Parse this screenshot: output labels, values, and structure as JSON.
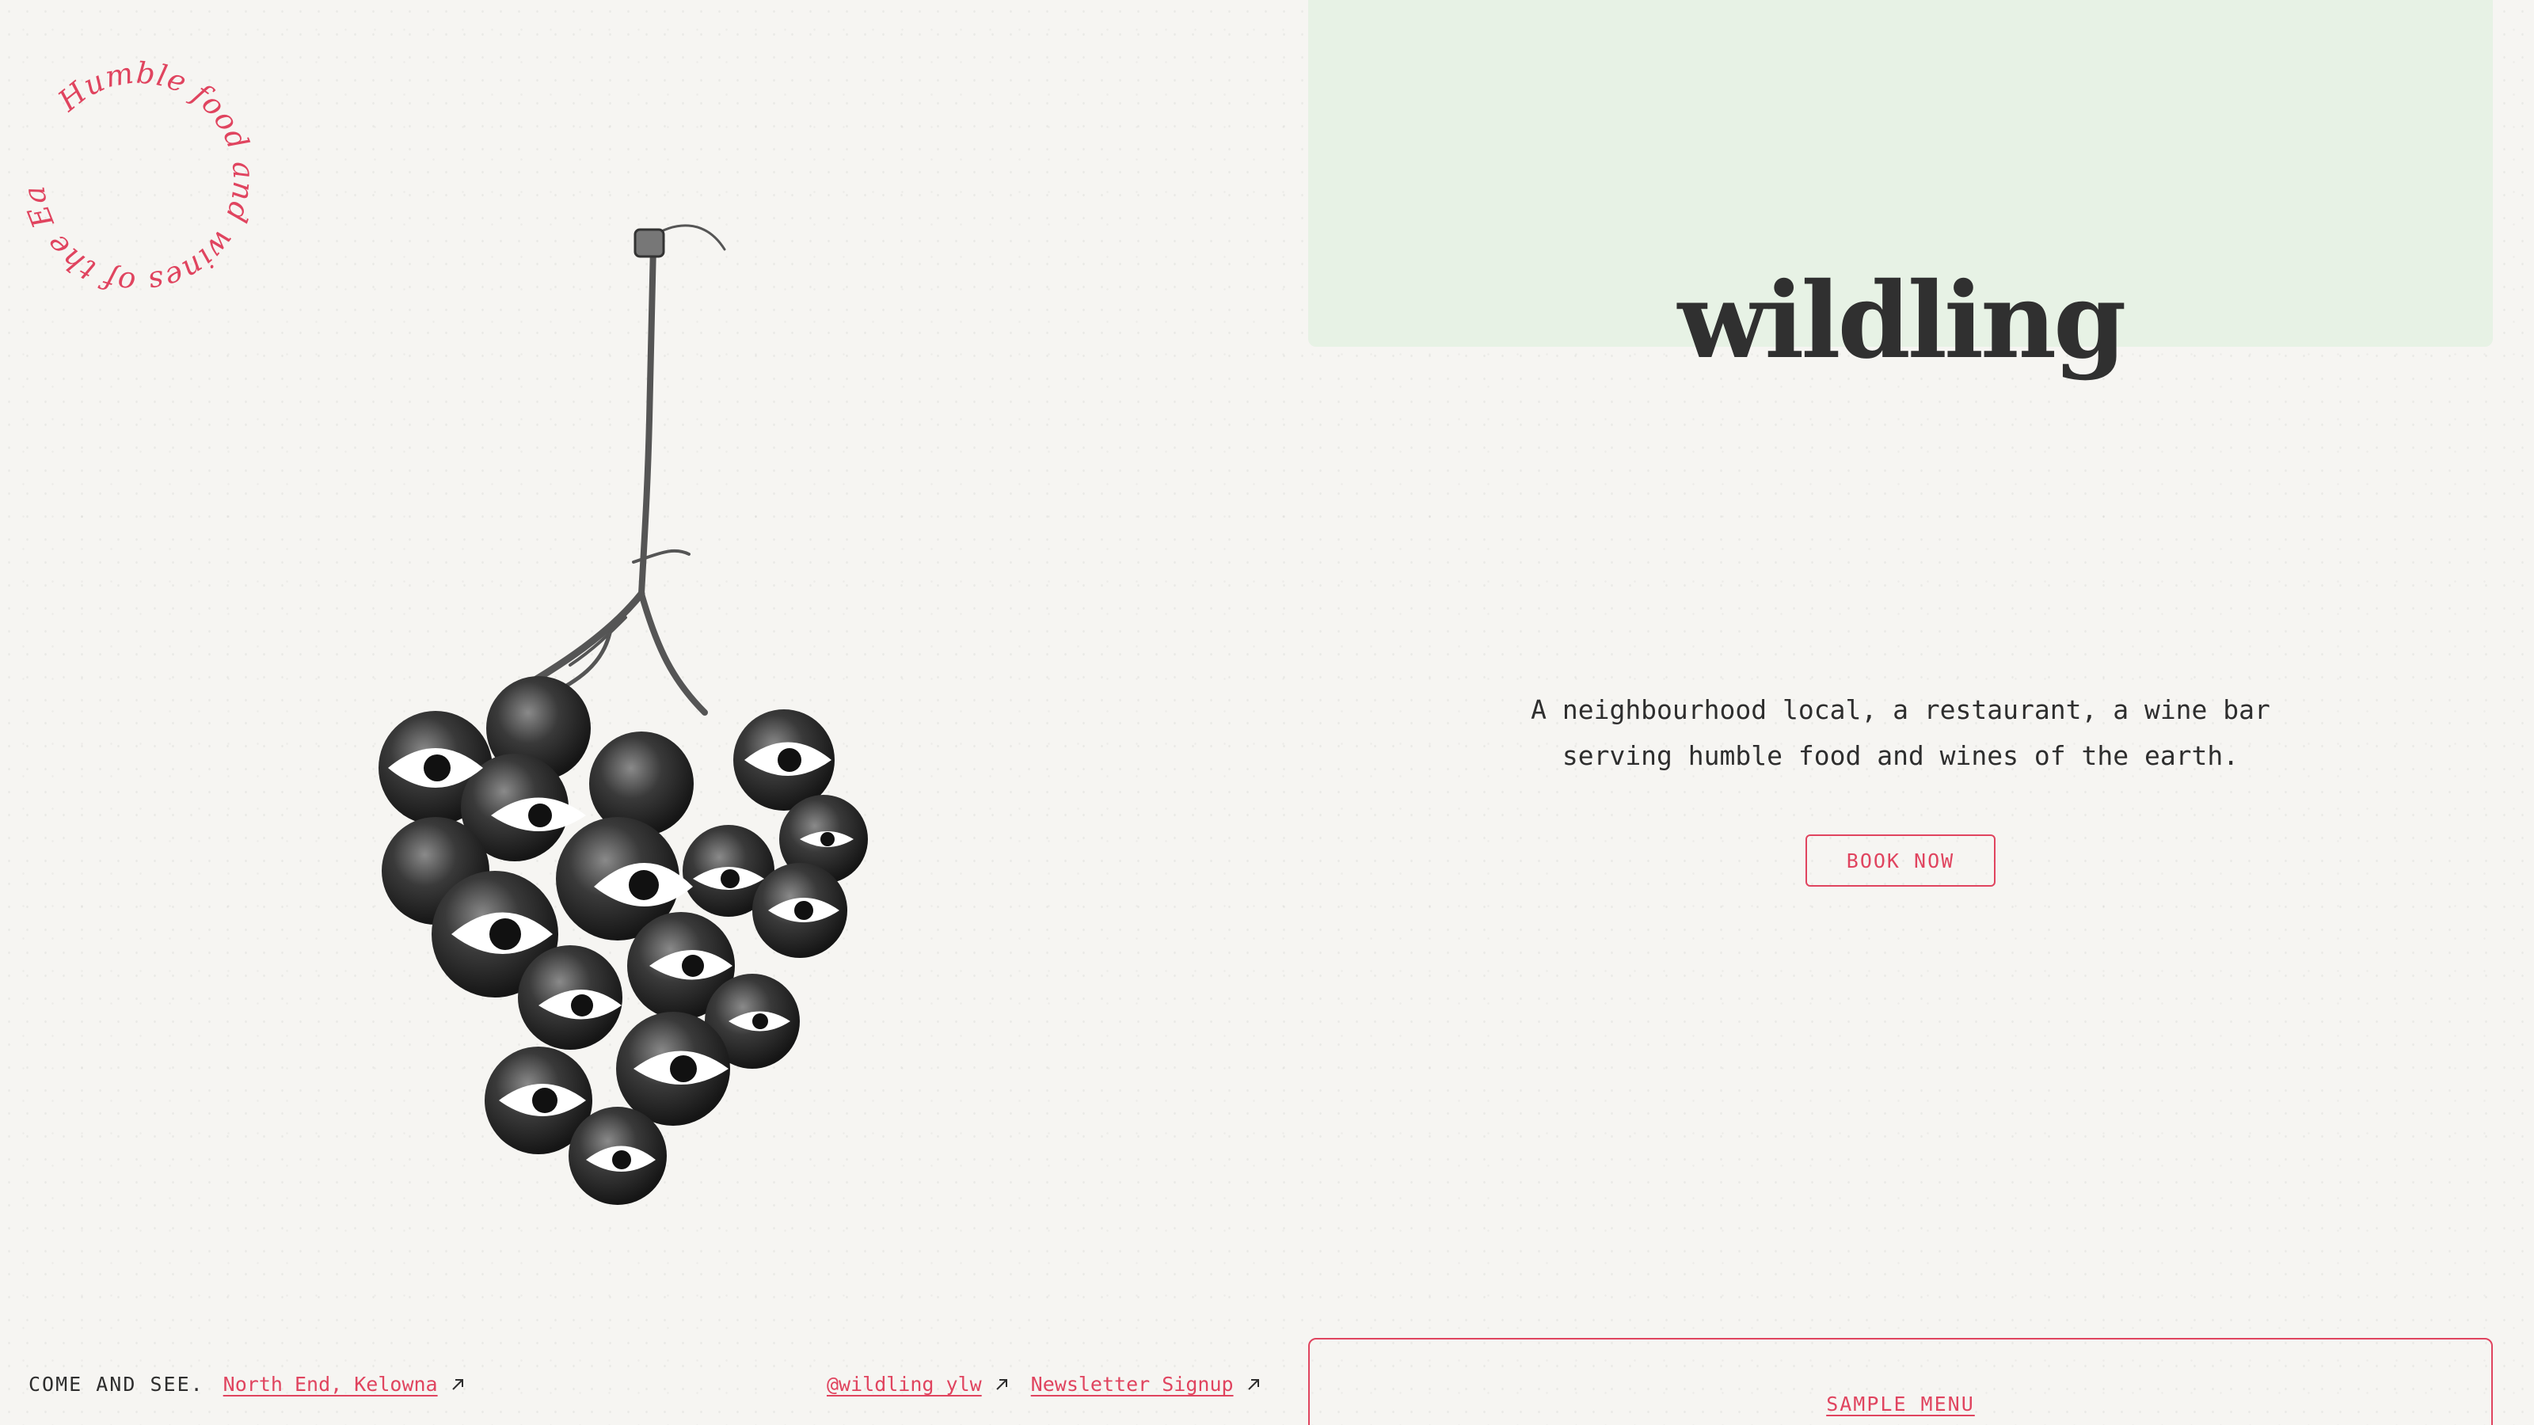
{
  "badge": {
    "text": "Humble food and wines of the Earth."
  },
  "brand": {
    "name": "wildling"
  },
  "hero": {
    "tagline_line1": "A neighbourhood local, a restaurant, a wine bar",
    "tagline_line2": "serving humble food and wines of the earth.",
    "book_label": "BOOK NOW"
  },
  "footer": {
    "come_label": "COME AND SEE.",
    "location_link": "North End, Kelowna",
    "instagram_link": "@wildling_ylw",
    "newsletter_link": "Newsletter Signup",
    "menu_link": "SAMPLE MENU"
  },
  "colors": {
    "accent": "#e0445f",
    "green_block": "#e7f2e5",
    "background": "#f6f5f2",
    "text": "#2e2e2e"
  },
  "icons": {
    "external": "arrow-up-right-icon"
  }
}
